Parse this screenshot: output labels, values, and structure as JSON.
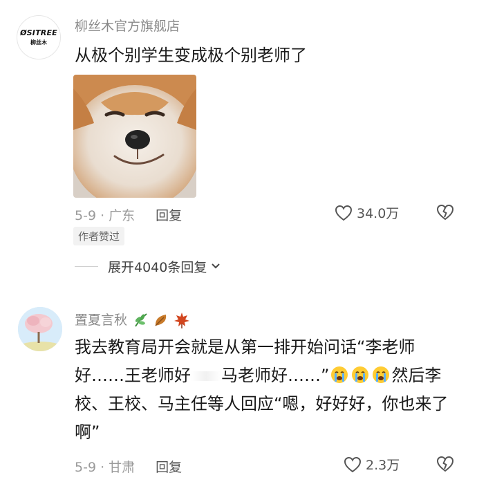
{
  "comments": [
    {
      "avatar": {
        "brand_en": "ØSITREE",
        "brand_cn": "柳丝木"
      },
      "username": "柳丝木官方旗舰店",
      "text": "从极个别学生变成极个别老师了",
      "image_icon": "shiba-dog-meme",
      "meta": {
        "date_location": "5-9 · 广东",
        "reply": "回复"
      },
      "likes": "34.0万",
      "badge": "作者赞过",
      "expand": "展开4040条回复"
    },
    {
      "username": "置夏言秋",
      "username_emojis": [
        "herb-emoji",
        "fallen-leaf-emoji",
        "maple-leaf-emoji"
      ],
      "text_part1": "我去教育局开会就是从第一排开始问话“李老师好……王老师好",
      "text_part2": "马老师好……”",
      "text_part3": "然后李校、王校、马主任等人回应“嗯，好好好，你也来了啊”",
      "inline_emoji": "loudly-crying-emoji",
      "meta": {
        "date_location": "5-9 · 甘肃",
        "reply": "回复"
      },
      "likes": "2.3万"
    }
  ],
  "colors": {
    "username": "#8a8a8a",
    "text": "#1a1a1a",
    "meta": "#9a9a9a"
  }
}
